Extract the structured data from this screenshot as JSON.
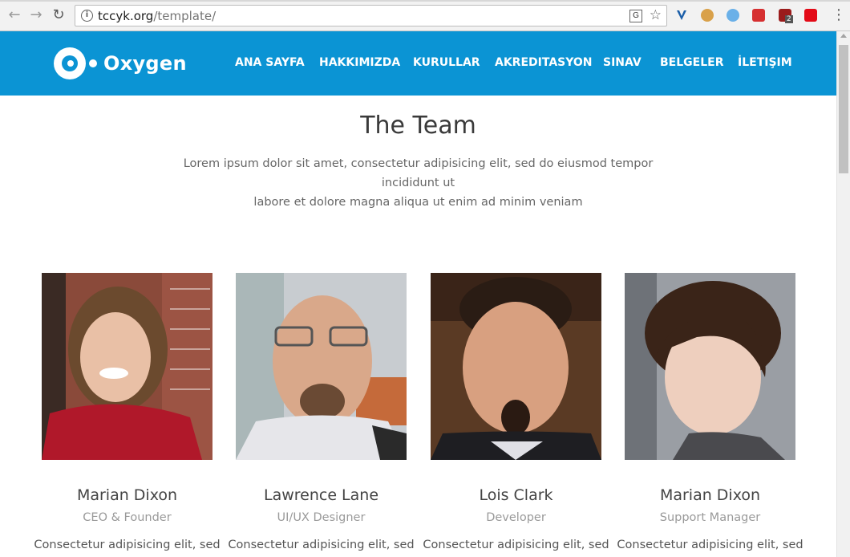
{
  "browser": {
    "url_host": "tccyk.org",
    "url_path": "/template/",
    "back_icon": "back-arrow-icon",
    "forward_icon": "forward-arrow-icon",
    "reload_icon": "reload-icon",
    "ext_badge": "2"
  },
  "site": {
    "brand": "Oxygen",
    "nav": [
      {
        "label": "ANA SAYFA"
      },
      {
        "label": "HAKKIMIZDA"
      },
      {
        "label": "KURULLAR"
      },
      {
        "label": "AKREDITASYON"
      },
      {
        "label": "SINAV"
      },
      {
        "label": "BELGELER"
      },
      {
        "label": "İLETIŞIM"
      }
    ],
    "accent_color": "#0b94d4"
  },
  "section": {
    "title": "The Team",
    "intro_line1": "Lorem ipsum dolor sit amet, consectetur adipisicing elit, sed do eiusmod tempor incididunt ut",
    "intro_line2": "labore et dolore magna aliqua ut enim ad minim veniam"
  },
  "team": [
    {
      "name": "Marian Dixon",
      "role": "CEO & Founder",
      "desc": "Consectetur adipisicing elit, sed"
    },
    {
      "name": "Lawrence Lane",
      "role": "UI/UX Designer",
      "desc": "Consectetur adipisicing elit, sed"
    },
    {
      "name": "Lois Clark",
      "role": "Developer",
      "desc": "Consectetur adipisicing elit, sed"
    },
    {
      "name": "Marian Dixon",
      "role": "Support Manager",
      "desc": "Consectetur adipisicing elit, sed"
    }
  ]
}
